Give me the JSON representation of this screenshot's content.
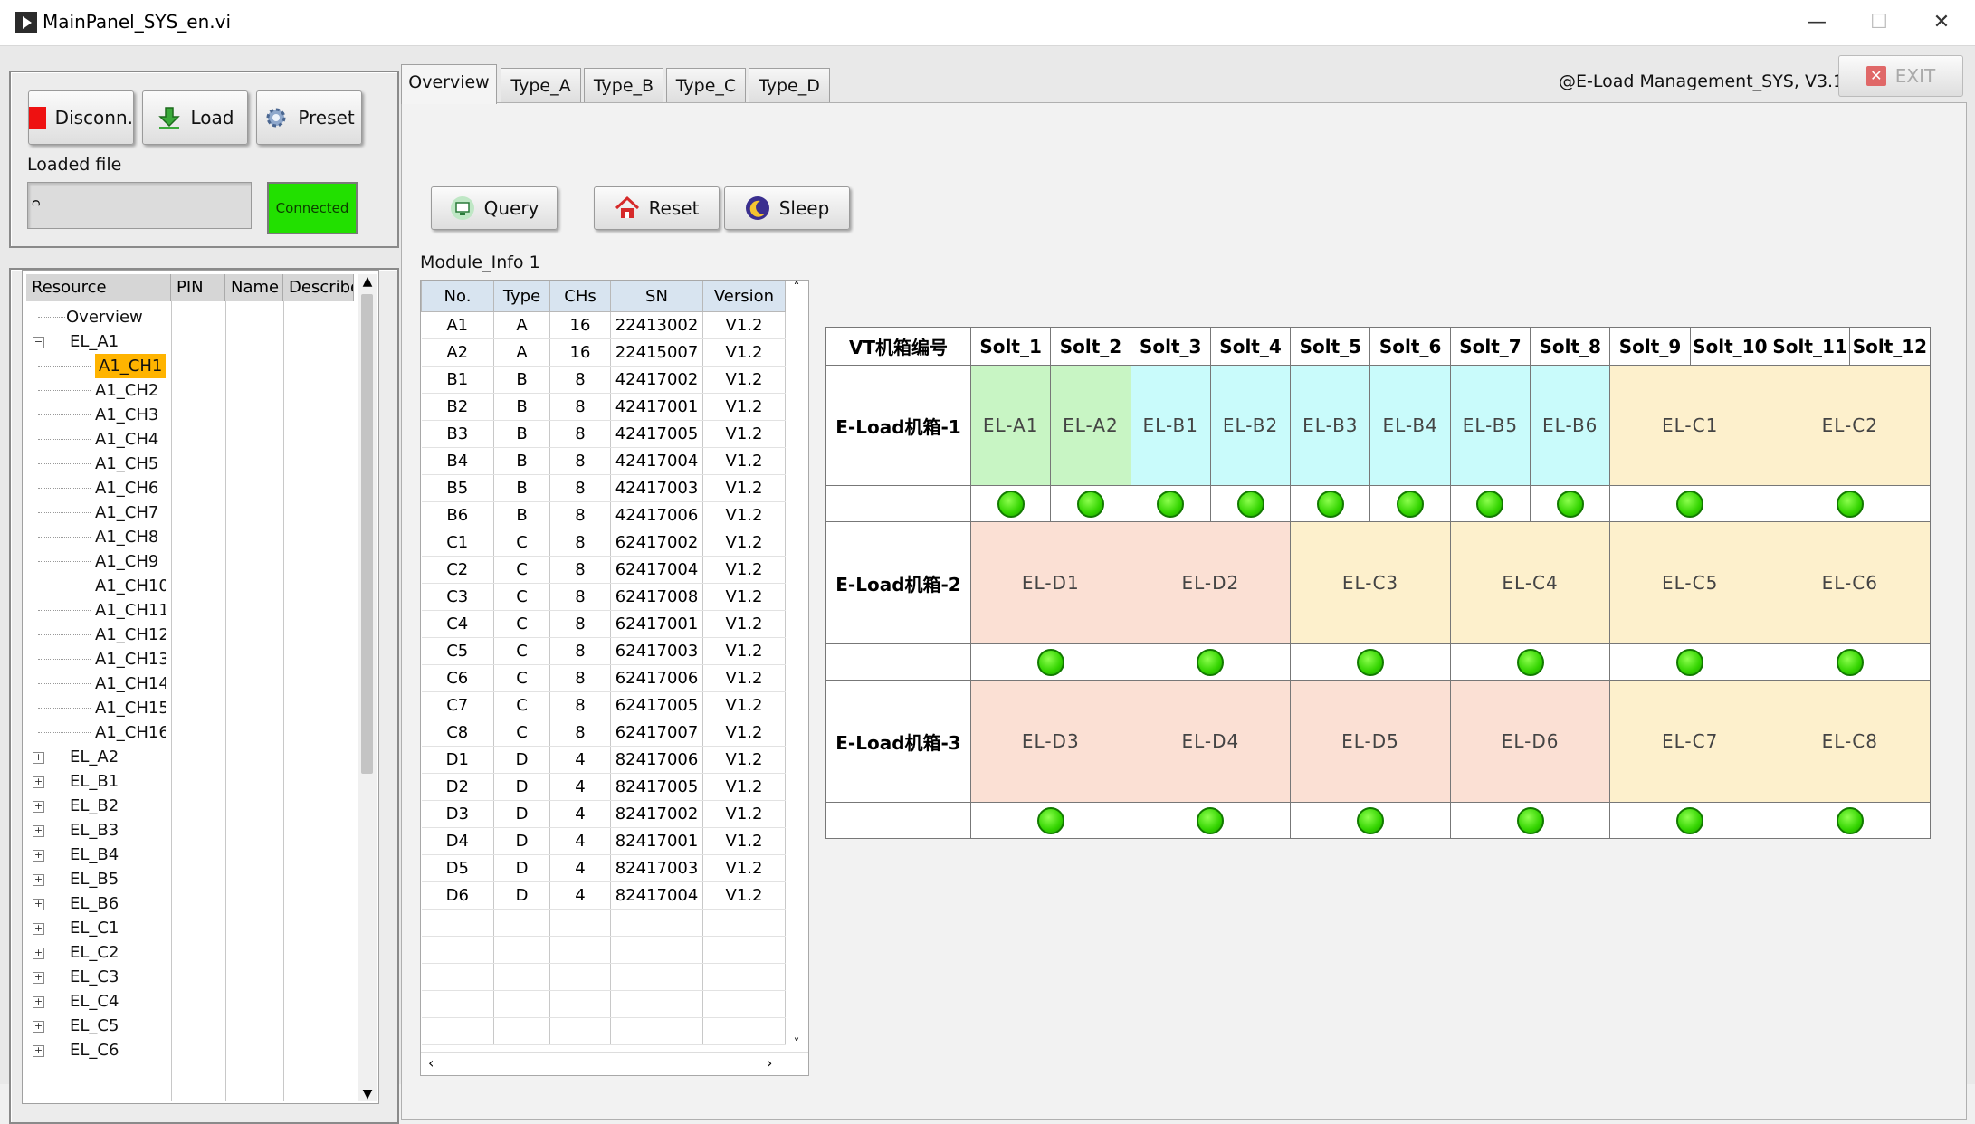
{
  "window": {
    "title": "MainPanel_SYS_en.vi",
    "controls": [
      "—",
      "☐",
      "✕"
    ]
  },
  "toolbar": {
    "disconnect_label": "Disconn.",
    "load_label": "Load",
    "preset_label": "Preset",
    "loaded_file_label": "Loaded file",
    "loaded_file_value": "",
    "status_label": "Connected",
    "status_color": "#22e000"
  },
  "tabs": [
    {
      "label": "Overview",
      "active": true
    },
    {
      "label": "Type_A"
    },
    {
      "label": "Type_B"
    },
    {
      "label": "Type_C"
    },
    {
      "label": "Type_D"
    }
  ],
  "header": {
    "app_version": "@E-Load Management_SYS,  V3.1",
    "exit_label": "EXIT"
  },
  "actions": {
    "query_label": "Query",
    "reset_label": "Reset",
    "sleep_label": "Sleep"
  },
  "tree": {
    "columns": [
      "Resource",
      "PIN",
      "Name",
      "Describe"
    ],
    "items": [
      {
        "label": "Overview",
        "level": 1
      },
      {
        "label": "EL_A1",
        "level": 0,
        "expander": "−"
      },
      {
        "label": "A1_CH1",
        "level": 2,
        "selected": true
      },
      {
        "label": "A1_CH2",
        "level": 2
      },
      {
        "label": "A1_CH3",
        "level": 2
      },
      {
        "label": "A1_CH4",
        "level": 2
      },
      {
        "label": "A1_CH5",
        "level": 2
      },
      {
        "label": "A1_CH6",
        "level": 2
      },
      {
        "label": "A1_CH7",
        "level": 2
      },
      {
        "label": "A1_CH8",
        "level": 2
      },
      {
        "label": "A1_CH9",
        "level": 2
      },
      {
        "label": "A1_CH10",
        "level": 2
      },
      {
        "label": "A1_CH11",
        "level": 2
      },
      {
        "label": "A1_CH12",
        "level": 2
      },
      {
        "label": "A1_CH13",
        "level": 2
      },
      {
        "label": "A1_CH14",
        "level": 2
      },
      {
        "label": "A1_CH15",
        "level": 2
      },
      {
        "label": "A1_CH16",
        "level": 2
      },
      {
        "label": "EL_A2",
        "level": 0,
        "expander": "+"
      },
      {
        "label": "EL_B1",
        "level": 0,
        "expander": "+"
      },
      {
        "label": "EL_B2",
        "level": 0,
        "expander": "+"
      },
      {
        "label": "EL_B3",
        "level": 0,
        "expander": "+"
      },
      {
        "label": "EL_B4",
        "level": 0,
        "expander": "+"
      },
      {
        "label": "EL_B5",
        "level": 0,
        "expander": "+"
      },
      {
        "label": "EL_B6",
        "level": 0,
        "expander": "+"
      },
      {
        "label": "EL_C1",
        "level": 0,
        "expander": "+"
      },
      {
        "label": "EL_C2",
        "level": 0,
        "expander": "+"
      },
      {
        "label": "EL_C3",
        "level": 0,
        "expander": "+"
      },
      {
        "label": "EL_C4",
        "level": 0,
        "expander": "+"
      },
      {
        "label": "EL_C5",
        "level": 0,
        "expander": "+"
      },
      {
        "label": "EL_C6",
        "level": 0,
        "expander": "+"
      }
    ]
  },
  "module_info": {
    "title": "Module_Info 1",
    "columns": [
      "No.",
      "Type",
      "CHs",
      "SN",
      "Version"
    ],
    "rows": [
      [
        "A1",
        "A",
        "16",
        "22413002",
        "V1.2"
      ],
      [
        "A2",
        "A",
        "16",
        "22415007",
        "V1.2"
      ],
      [
        "B1",
        "B",
        "8",
        "42417002",
        "V1.2"
      ],
      [
        "B2",
        "B",
        "8",
        "42417001",
        "V1.2"
      ],
      [
        "B3",
        "B",
        "8",
        "42417005",
        "V1.2"
      ],
      [
        "B4",
        "B",
        "8",
        "42417004",
        "V1.2"
      ],
      [
        "B5",
        "B",
        "8",
        "42417003",
        "V1.2"
      ],
      [
        "B6",
        "B",
        "8",
        "42417006",
        "V1.2"
      ],
      [
        "C1",
        "C",
        "8",
        "62417002",
        "V1.2"
      ],
      [
        "C2",
        "C",
        "8",
        "62417004",
        "V1.2"
      ],
      [
        "C3",
        "C",
        "8",
        "62417008",
        "V1.2"
      ],
      [
        "C4",
        "C",
        "8",
        "62417001",
        "V1.2"
      ],
      [
        "C5",
        "C",
        "8",
        "62417003",
        "V1.2"
      ],
      [
        "C6",
        "C",
        "8",
        "62417006",
        "V1.2"
      ],
      [
        "C7",
        "C",
        "8",
        "62417005",
        "V1.2"
      ],
      [
        "C8",
        "C",
        "8",
        "62417007",
        "V1.2"
      ],
      [
        "D1",
        "D",
        "4",
        "82417006",
        "V1.2"
      ],
      [
        "D2",
        "D",
        "4",
        "82417005",
        "V1.2"
      ],
      [
        "D3",
        "D",
        "4",
        "82417002",
        "V1.2"
      ],
      [
        "D4",
        "D",
        "4",
        "82417001",
        "V1.2"
      ],
      [
        "D5",
        "D",
        "4",
        "82417003",
        "V1.2"
      ],
      [
        "D6",
        "D",
        "4",
        "82417004",
        "V1.2"
      ]
    ]
  },
  "chassis": {
    "header": "VT机箱编号",
    "slots": [
      "Solt_1",
      "Solt_2",
      "Solt_3",
      "Solt_4",
      "Solt_5",
      "Solt_6",
      "Solt_7",
      "Solt_8",
      "Solt_9",
      "Solt_10",
      "Solt_11",
      "Solt_12"
    ],
    "colors": {
      "A": "#c8f5c4",
      "B": "#c9fbfb",
      "C": "#fdf0cc",
      "D": "#fbe0d4",
      "led": "#33d400"
    },
    "rows": [
      {
        "name": "E-Load机箱-1",
        "cells": [
          {
            "label": "EL-A1",
            "span": 1,
            "type": "A"
          },
          {
            "label": "EL-A2",
            "span": 1,
            "type": "A"
          },
          {
            "label": "EL-B1",
            "span": 1,
            "type": "B"
          },
          {
            "label": "EL-B2",
            "span": 1,
            "type": "B"
          },
          {
            "label": "EL-B3",
            "span": 1,
            "type": "B"
          },
          {
            "label": "EL-B4",
            "span": 1,
            "type": "B"
          },
          {
            "label": "EL-B5",
            "span": 1,
            "type": "B"
          },
          {
            "label": "EL-B6",
            "span": 1,
            "type": "B"
          },
          {
            "label": "EL-C1",
            "span": 2,
            "type": "C"
          },
          {
            "label": "EL-C2",
            "span": 2,
            "type": "C"
          }
        ]
      },
      {
        "name": "E-Load机箱-2",
        "cells": [
          {
            "label": "EL-D1",
            "span": 2,
            "type": "D"
          },
          {
            "label": "EL-D2",
            "span": 2,
            "type": "D"
          },
          {
            "label": "EL-C3",
            "span": 2,
            "type": "C"
          },
          {
            "label": "EL-C4",
            "span": 2,
            "type": "C"
          },
          {
            "label": "EL-C5",
            "span": 2,
            "type": "C"
          },
          {
            "label": "EL-C6",
            "span": 2,
            "type": "C"
          }
        ]
      },
      {
        "name": "E-Load机箱-3",
        "cells": [
          {
            "label": "EL-D3",
            "span": 2,
            "type": "D"
          },
          {
            "label": "EL-D4",
            "span": 2,
            "type": "D"
          },
          {
            "label": "EL-D5",
            "span": 2,
            "type": "D"
          },
          {
            "label": "EL-D6",
            "span": 2,
            "type": "D"
          },
          {
            "label": "EL-C7",
            "span": 2,
            "type": "C"
          },
          {
            "label": "EL-C8",
            "span": 2,
            "type": "C"
          }
        ]
      }
    ]
  }
}
